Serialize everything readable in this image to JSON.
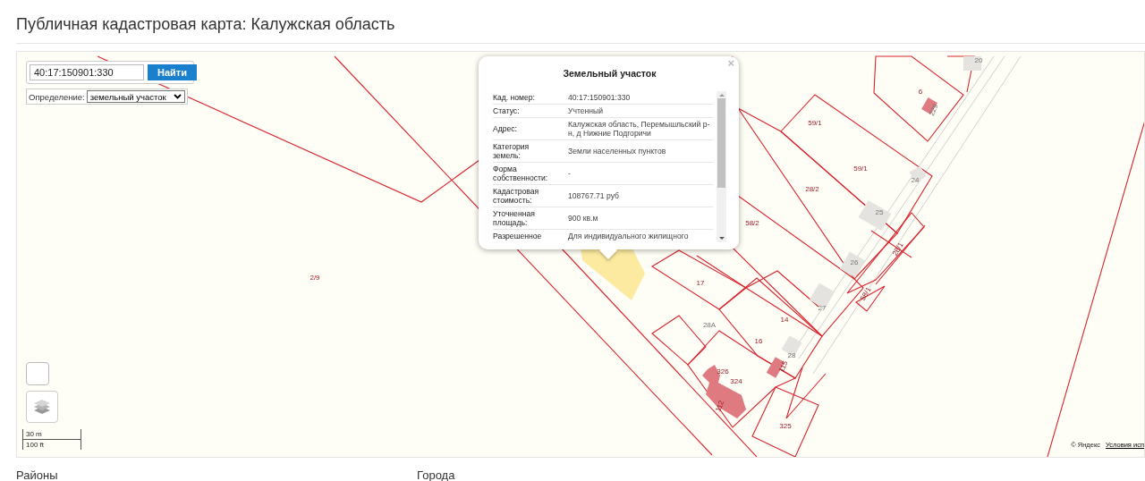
{
  "page": {
    "title": "Публичная кадастровая карта: Калужская область"
  },
  "search": {
    "value": "40:17:150901:330",
    "button": "Найти"
  },
  "definition": {
    "label": "Определение:",
    "value": "земельный участок"
  },
  "popup": {
    "title": "Земельный участок",
    "close": "×",
    "rows": [
      {
        "label": "Кад. номер:",
        "value": "40:17:150901:330"
      },
      {
        "label": "Статус:",
        "value": "Учтенный"
      },
      {
        "label": "Адрес:",
        "value": "Калужская область, Перемышльский р-н, д Нижние Подгоричи"
      },
      {
        "label": "Категория земель:",
        "value": "Земли населенных пунктов"
      },
      {
        "label": "Форма собственности:",
        "value": "-"
      },
      {
        "label": "Кадастровая стоимость:",
        "value": "108767.71 руб"
      },
      {
        "label": "Уточненная площадь:",
        "value": "900 кв.м"
      },
      {
        "label": "Разрешенное",
        "value": "Для индивидуального жилищного"
      }
    ]
  },
  "map": {
    "parcel_labels": [
      "2/9",
      "59/1",
      "59/1",
      "28/2",
      "58/2",
      "6",
      "229",
      "25",
      "24",
      "20",
      "26",
      "28/1",
      "58/1",
      "17",
      "14",
      "27",
      "28А",
      "16",
      "115",
      "28",
      "326",
      "324",
      "112",
      "325"
    ],
    "scale": [
      "30 m",
      "100 ft"
    ],
    "attribution": "© Яндекс",
    "terms_link": "Условия исп"
  },
  "sections": [
    "Районы",
    "Города"
  ]
}
